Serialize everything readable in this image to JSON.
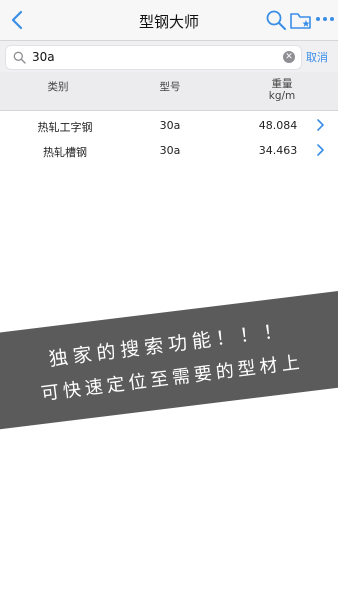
{
  "nav": {
    "title": "型钢大师",
    "back_icon": "chevron-left-icon",
    "search_icon": "search-icon",
    "folder_icon": "folder-star-icon",
    "more_icon": "more-icon",
    "accent_color": "#3a8ee6"
  },
  "search": {
    "value": "30a",
    "cancel_label": "取消"
  },
  "table": {
    "headers": {
      "category": "类别",
      "model": "型号",
      "weight": "重量",
      "weight_unit": "kg/m"
    },
    "rows": [
      {
        "category": "热轧工字钢",
        "model": "30a",
        "weight": "48.084"
      },
      {
        "category": "热轧槽钢",
        "model": "30a",
        "weight": "34.463"
      }
    ]
  },
  "banner": {
    "line1": "独家的搜索功能！！！",
    "line2": "可快速定位至需要的型材上"
  }
}
